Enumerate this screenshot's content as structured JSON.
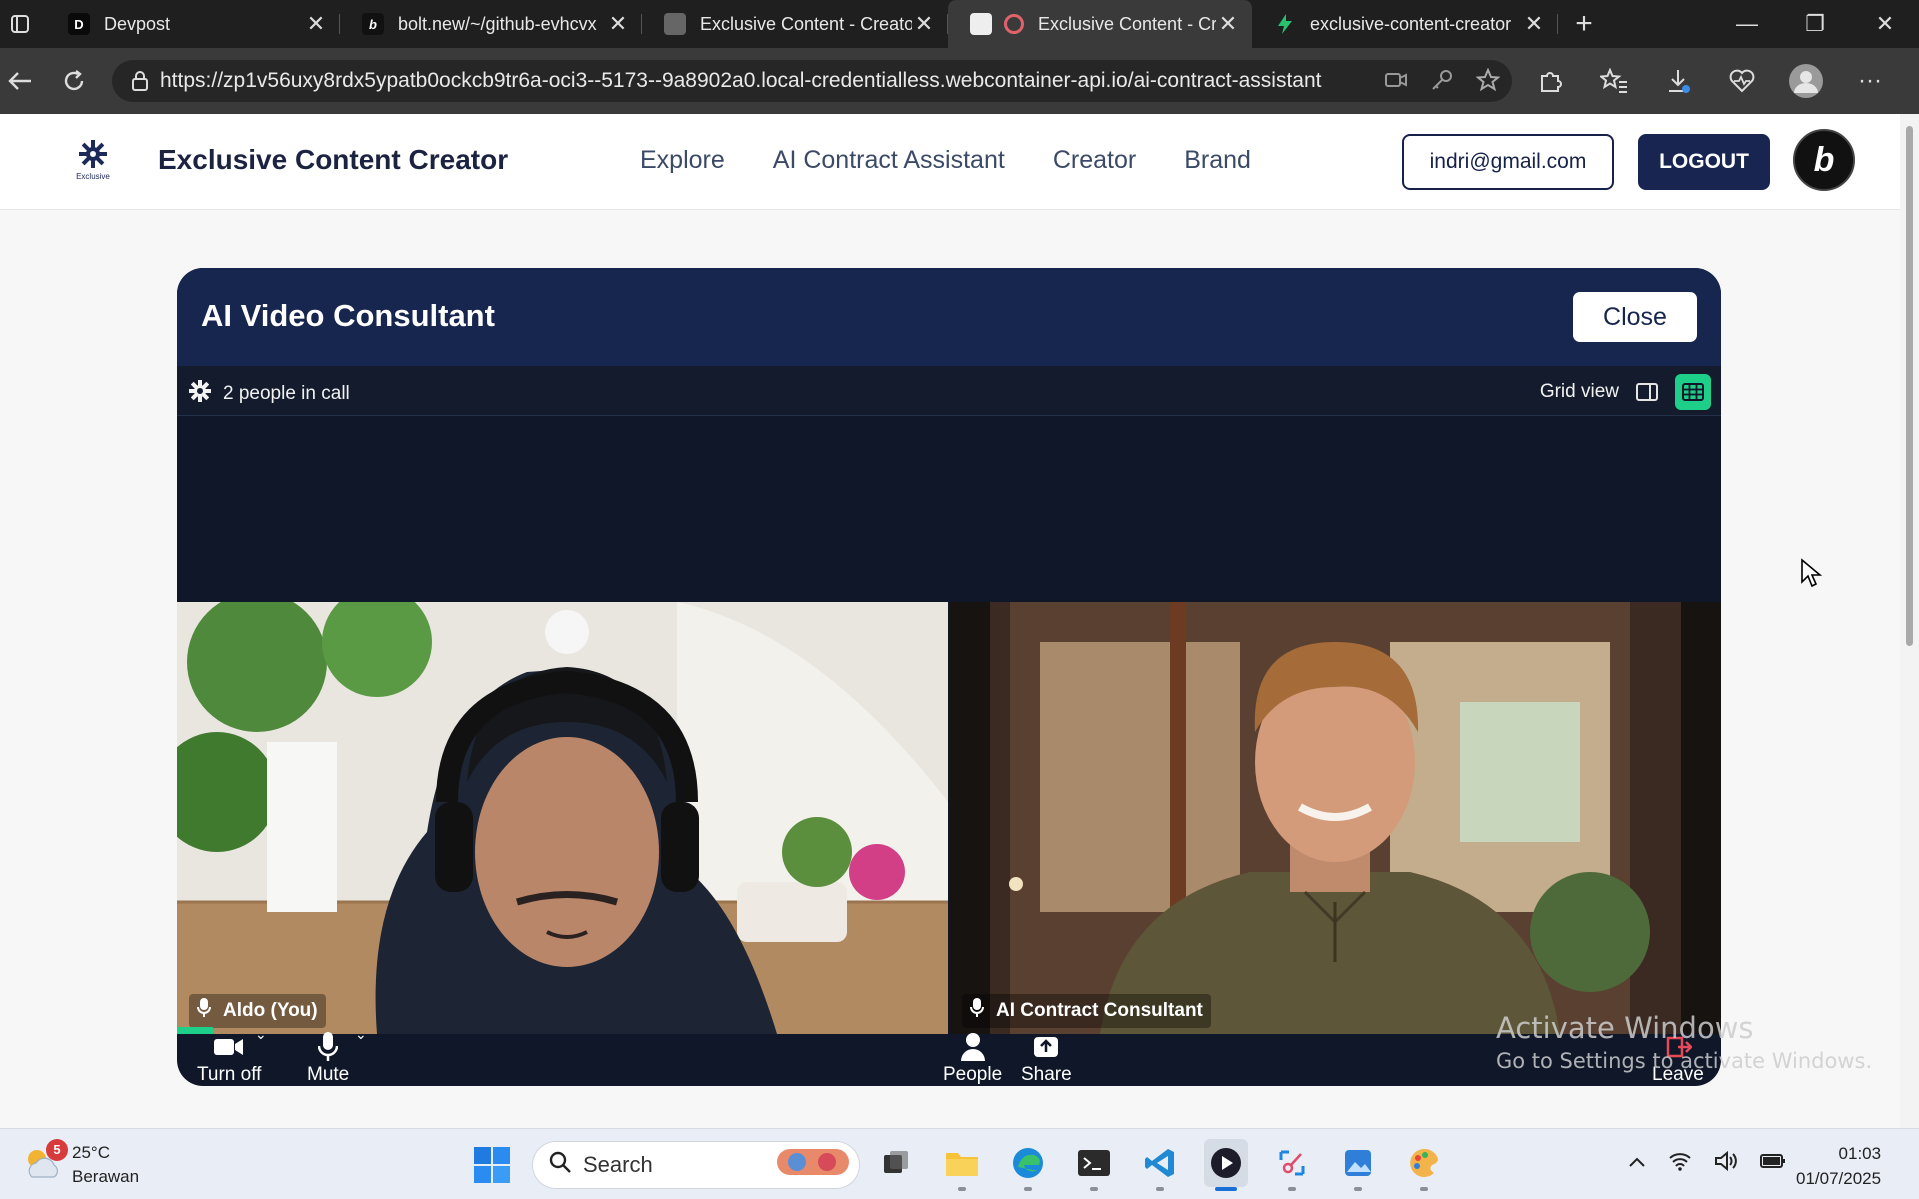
{
  "browser": {
    "tabs": [
      {
        "title": "Devpost",
        "favicon": "D"
      },
      {
        "title": "bolt.new/~/github-evhcvx",
        "favicon": "b"
      },
      {
        "title": "Exclusive Content - Creator",
        "favicon": ""
      },
      {
        "title": "Exclusive Content - Cr",
        "favicon": ""
      },
      {
        "title": "exclusive-content-creator",
        "favicon": ""
      }
    ],
    "active_tab_index": 3,
    "url": "https://zp1v56uxy8rdx5ypatb0ockcb9tr6a-oci3--5173--9a8902a0.local-credentialless.webcontainer-api.io/ai-contract-assistant"
  },
  "app": {
    "logo_caption": "Exclusive",
    "name": "Exclusive Content Creator",
    "nav": [
      "Explore",
      "AI Contract Assistant",
      "Creator",
      "Brand"
    ],
    "user_email": "indri@gmail.com",
    "logout_label": "LOGOUT",
    "badge_letter": "b"
  },
  "modal": {
    "title": "AI Video Consultant",
    "close_label": "Close",
    "call_count": "2 people in call",
    "view_label": "Grid view",
    "participants": [
      {
        "name": "Aldo (You)"
      },
      {
        "name": "AI Contract Consultant"
      }
    ],
    "controls": {
      "camera": "Turn off",
      "mic": "Mute",
      "people": "People",
      "share": "Share",
      "leave": "Leave"
    }
  },
  "watermark": {
    "line1": "Activate Windows",
    "line2": "Go to Settings to activate Windows."
  },
  "taskbar": {
    "weather_temp": "25°C",
    "weather_desc": "Berawan",
    "weather_badge": "5",
    "search_placeholder": "Search",
    "time": "01:03",
    "date": "01/07/2025"
  },
  "colors": {
    "brand_navy": "#17264e",
    "accent_green": "#1ecf89",
    "modal_bg": "#0f1729"
  }
}
